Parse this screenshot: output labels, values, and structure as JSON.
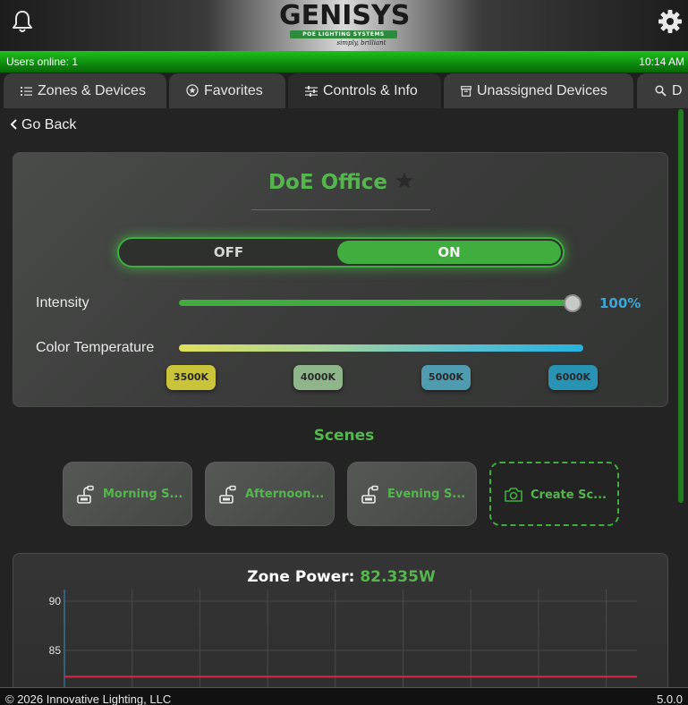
{
  "header": {
    "logo": {
      "brand": "GENISYS",
      "sub": "POE LIGHTING SYSTEMS",
      "tagline": "simply, brilliant"
    },
    "icons": {
      "left": "bell-icon",
      "right": "gear-icon"
    }
  },
  "status": {
    "users": "Users online: 1",
    "time": "10:14 AM"
  },
  "tabs": [
    {
      "label": "Zones & Devices",
      "icon": "list-icon"
    },
    {
      "label": "Favorites",
      "icon": "star-circle-icon"
    },
    {
      "label": "Controls & Info",
      "icon": "sliders-icon",
      "active": true
    },
    {
      "label": "Unassigned Devices",
      "icon": "archive-icon"
    },
    {
      "label": "D",
      "icon": "search-icon"
    }
  ],
  "nav": {
    "back_label": "Go Back"
  },
  "zone": {
    "name": "DoE Office",
    "favorite": false,
    "power_off_label": "OFF",
    "power_on_label": "ON",
    "power_state": "ON",
    "intensity_label": "Intensity",
    "intensity_value": 1.0,
    "intensity_display": "100%",
    "color_temp_label": "Color Temperature",
    "color_temps": [
      {
        "label": "3500K",
        "color": "#c9c43a"
      },
      {
        "label": "4000K",
        "color": "#8fb58a"
      },
      {
        "label": "5000K",
        "color": "#4f9bb0"
      },
      {
        "label": "6000K",
        "color": "#2893b3"
      }
    ]
  },
  "scenes": {
    "title": "Scenes",
    "items": [
      {
        "label": "Morning S...",
        "icon": "lamp-icon"
      },
      {
        "label": "Afternoon...",
        "icon": "lamp-icon"
      },
      {
        "label": "Evening S...",
        "icon": "lamp-icon"
      }
    ],
    "create_label": "Create Sc...",
    "create_icon": "camera-icon"
  },
  "power": {
    "title_label": "Zone Power:",
    "title_value": "82.335W"
  },
  "chart_data": {
    "type": "line",
    "title": "Zone Power: 82.335W",
    "ytick_labels": [
      "90",
      "85"
    ],
    "ylim": [
      80,
      90
    ],
    "series": [
      {
        "values": [
          82.335,
          82.335
        ],
        "color": "#d6294a"
      }
    ],
    "grid": true
  },
  "footer": {
    "copyright": "© 2026 Innovative Lighting, LLC",
    "version": "5.0.0"
  },
  "colors": {
    "accent_green": "#55b64e",
    "toggle_green": "#3fae3f",
    "status_green": "#13a313",
    "percent_blue": "#3aa8d8"
  }
}
